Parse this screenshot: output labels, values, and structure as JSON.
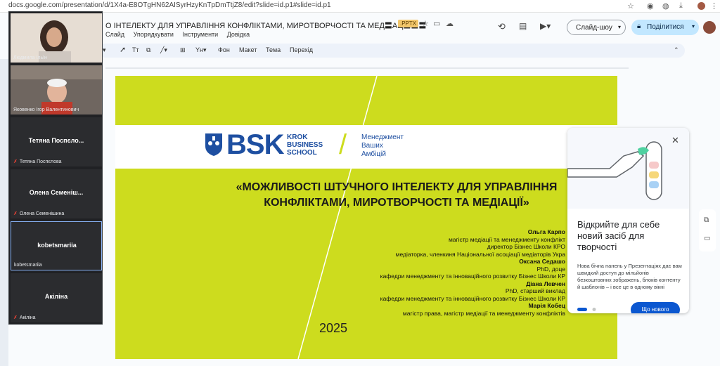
{
  "browser": {
    "url": "docs.google.com/presentation/d/1X4a-E8OTgHN62AISyrHzyKnTpDmTtjZ8/edit?slide=id.p1#slide=id.p1"
  },
  "docs": {
    "title": "О ІНТЕЛЕКТУ ДЛЯ УПРАВЛІННЯ КОНФЛІКТАМИ, МИРОТВОРЧОСТІ ТА МЕД〓АЦ〓〓〓",
    "file_badge": ".PPTX",
    "menu": [
      "Слайд",
      "Упорядкувати",
      "Інструменти",
      "Довідка"
    ],
    "slideshow_label": "Слайд-шоу",
    "share_label": "Поділитися",
    "toolbar": {
      "background": "Фон",
      "layout": "Макет",
      "theme": "Тема",
      "transition": "Перехід"
    }
  },
  "slide": {
    "logo_text": "BSK",
    "school_line1": "KROK",
    "school_line2": "BUSINESS",
    "school_line3": "SCHOOL",
    "motto_line1": "Менеджмент",
    "motto_line2": "Ваших",
    "motto_line3": "Амбіцій",
    "title": "«МОЖЛИВОСТІ ШТУЧНОГО ІНТЕЛЕКТУ ДЛЯ УПРАВЛІННЯ КОНФЛІКТАМИ, МИРОТВОРЧОСТІ ТА МЕДІАЦІЇ»",
    "authors": [
      {
        "name": "Ольга Карпо",
        "lines": [
          "магістр медіації та менеджменту конфлікт",
          "директор Бізнес Школи КРО",
          "медіаторка, членкиня Національної асоціації медіаторів Укра"
        ]
      },
      {
        "name": "Оксана Седашо",
        "lines": [
          "PhD, доце",
          "кафедри менеджменту та інноваційного розвитку Бізнес Школи КР"
        ]
      },
      {
        "name": "Діана Левчен",
        "lines": [
          "PhD, старший виклад",
          "кафедри менеджменту та інноваційного розвитку Бізнес Школи КР"
        ]
      },
      {
        "name": "Марія Кобец",
        "lines": [
          "магістр права, магістр медіації та менеджменту конфліктів"
        ]
      }
    ],
    "year": "2025"
  },
  "meet": {
    "participants": [
      {
        "name": "Людмила Ільїн",
        "center": "",
        "muted": false
      },
      {
        "name": "Яковенко Ігор Валентинович",
        "center": "",
        "muted": false
      },
      {
        "name": "Тетяна Поспєлова",
        "center": "Тетяна Поспєло...",
        "muted": true
      },
      {
        "name": "Олена Семенішина",
        "center": "Олена Семеніш...",
        "muted": true
      },
      {
        "name": "kobetsmariia",
        "center": "kobetsmariia",
        "muted": false
      },
      {
        "name": "Акіліна",
        "center": "Акіліна",
        "muted": true
      }
    ]
  },
  "popup": {
    "title": "Відкрийте для себе новий засіб для творчості",
    "body": "Нова бічна панель у Презентаціях дає вам швидкий доступ до мільйонів безкоштовних зображень, блоків контенту й шаблонів – і все це в одному вікні",
    "button": "Що нового"
  },
  "colors": {
    "slide_bg": "#cddc1e",
    "brand_blue": "#1e4fa1",
    "share_bg": "#c2e7ff",
    "primary_button": "#0b57d0"
  }
}
